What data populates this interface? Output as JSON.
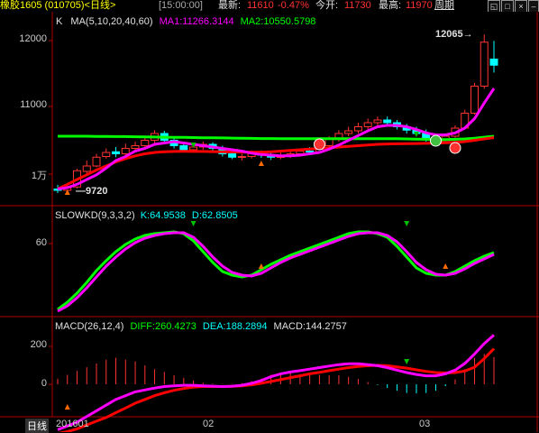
{
  "header": {
    "symbol": "橡胶1605 (010705)<日线>",
    "time": "[15:00:00]",
    "latest_label": "最新:",
    "latest_value": "11610",
    "change_pct": "-0.47%",
    "open_label": "今开:",
    "open_value": "11730",
    "high_label": "最高:",
    "high_value": "11970",
    "period_label": "周期"
  },
  "main_panel": {
    "k_label": "K",
    "ma_label": "MA(5,10,20,40,60)",
    "ma1": "MA1:11266.3144",
    "ma2": "MA2:10550.5798",
    "axis": [
      "12000",
      "11000",
      "1万"
    ],
    "high_mark": "12065",
    "low_mark": "9720",
    "colors": {
      "ma1": "#ff00ff",
      "ma2": "#00ff00",
      "ma3": "#ff0000",
      "up": "#ff3232",
      "down": "#00ffff"
    }
  },
  "kd_panel": {
    "label": "SLOWKD(9,3,3,2)",
    "k": "K:64.9538",
    "d": "D:62.8505",
    "axis": [
      "60"
    ]
  },
  "macd_panel": {
    "label": "MACD(26,12,4)",
    "diff": "DIFF:260.4273",
    "dea": "DEA:188.2894",
    "macd": "MACD:144.2757",
    "axis": [
      "200",
      "0"
    ]
  },
  "x_axis": {
    "period": "日线",
    "labels": [
      "201601",
      "02",
      "03"
    ]
  },
  "chart_data": {
    "type": "candlestick",
    "candles": [
      [
        9780,
        9760,
        9840,
        9720
      ],
      [
        9760,
        9800,
        9850,
        9740
      ],
      [
        9810,
        10050,
        10080,
        9790
      ],
      [
        10040,
        10120,
        10200,
        10000
      ],
      [
        10120,
        10250,
        10300,
        10100
      ],
      [
        10260,
        10320,
        10380,
        10230
      ],
      [
        10330,
        10300,
        10400,
        10250
      ],
      [
        10300,
        10380,
        10450,
        10280
      ],
      [
        10380,
        10420,
        10480,
        10340
      ],
      [
        10420,
        10500,
        10560,
        10380
      ],
      [
        10500,
        10600,
        10650,
        10460
      ],
      [
        10600,
        10500,
        10640,
        10450
      ],
      [
        10500,
        10420,
        10540,
        10380
      ],
      [
        10420,
        10360,
        10460,
        10320
      ],
      [
        10360,
        10400,
        10450,
        10330
      ],
      [
        10400,
        10440,
        10480,
        10360
      ],
      [
        10440,
        10380,
        10470,
        10330
      ],
      [
        10380,
        10300,
        10420,
        10260
      ],
      [
        10300,
        10250,
        10340,
        10220
      ],
      [
        10250,
        10260,
        10300,
        10200
      ],
      [
        10260,
        10310,
        10350,
        10230
      ],
      [
        10310,
        10280,
        10350,
        10240
      ],
      [
        10280,
        10250,
        10320,
        10210
      ],
      [
        10250,
        10260,
        10330,
        10220
      ],
      [
        10260,
        10300,
        10350,
        10240
      ],
      [
        10300,
        10340,
        10380,
        10270
      ],
      [
        10340,
        10330,
        10400,
        10290
      ],
      [
        10330,
        10420,
        10460,
        10300
      ],
      [
        10420,
        10520,
        10560,
        10400
      ],
      [
        10520,
        10600,
        10650,
        10480
      ],
      [
        10600,
        10640,
        10700,
        10560
      ],
      [
        10640,
        10700,
        10760,
        10600
      ],
      [
        10700,
        10760,
        10820,
        10660
      ],
      [
        10760,
        10800,
        10850,
        10720
      ],
      [
        10800,
        10760,
        10850,
        10700
      ],
      [
        10760,
        10700,
        10800,
        10660
      ],
      [
        10700,
        10650,
        10740,
        10600
      ],
      [
        10650,
        10600,
        10700,
        10560
      ],
      [
        10600,
        10520,
        10660,
        10480
      ],
      [
        10520,
        10480,
        10580,
        10440
      ],
      [
        10480,
        10560,
        10600,
        10450
      ],
      [
        10560,
        10680,
        10720,
        10540
      ],
      [
        10680,
        10900,
        10950,
        10660
      ],
      [
        10900,
        11300,
        11350,
        10880
      ],
      [
        11300,
        11950,
        12065,
        11260
      ],
      [
        11700,
        11610,
        11970,
        11500
      ]
    ],
    "ma1": [
      9780,
      9800,
      9850,
      9920,
      9990,
      10090,
      10200,
      10260,
      10340,
      10380,
      10440,
      10460,
      10480,
      10460,
      10440,
      10420,
      10400,
      10380,
      10360,
      10340,
      10310,
      10290,
      10280,
      10270,
      10270,
      10280,
      10300,
      10320,
      10370,
      10430,
      10500,
      10570,
      10640,
      10700,
      10720,
      10720,
      10700,
      10660,
      10610,
      10580,
      10580,
      10610,
      10680,
      10820,
      11050,
      11266
    ],
    "ma2": [
      10540,
      10540,
      10535,
      10530,
      10525,
      10520,
      10515,
      10510,
      10505,
      10500,
      10498,
      10496,
      10494,
      10492,
      10490,
      10488,
      10486,
      10484,
      10482,
      10480,
      10478,
      10476,
      10474,
      10472,
      10470,
      10470,
      10472,
      10474,
      10476,
      10478,
      10480,
      10482,
      10484,
      10486,
      10488,
      10490,
      10492,
      10494,
      10496,
      10498,
      10500,
      10505,
      10515,
      10525,
      10540,
      10550
    ],
    "ma3": [
      9780,
      9850,
      9920,
      9990,
      10060,
      10120,
      10180,
      10230,
      10270,
      10300,
      10320,
      10330,
      10335,
      10336,
      10335,
      10334,
      10332,
      10330,
      10328,
      10326,
      10325,
      10326,
      10330,
      10340,
      10350,
      10360,
      10370,
      10380,
      10390,
      10400,
      10410,
      10420,
      10430,
      10440,
      10445,
      10448,
      10450,
      10452,
      10455,
      10458,
      10462,
      10470,
      10480,
      10500,
      10520,
      10540
    ],
    "ma4": [
      10560,
      10560,
      10560,
      10560,
      10558,
      10556,
      10555,
      10554,
      10552,
      10550,
      10548,
      10546,
      10544,
      10542,
      10540,
      10538,
      10536,
      10534,
      10532,
      10530,
      10528,
      10526,
      10525,
      10524,
      10523,
      10522,
      10522,
      10522,
      10522,
      10522,
      10522,
      10522,
      10522,
      10522,
      10522,
      10522,
      10520,
      10518,
      10515,
      10512,
      10510,
      10515,
      10520,
      10530,
      10545,
      10560
    ],
    "kd_k": [
      2,
      10,
      20,
      32,
      45,
      56,
      66,
      74,
      80,
      84,
      86,
      87,
      88,
      86,
      78,
      66,
      54,
      44,
      40,
      38,
      40,
      46,
      52,
      57,
      62,
      66,
      70,
      74,
      78,
      82,
      86,
      88,
      88,
      86,
      82,
      72,
      60,
      48,
      42,
      40,
      40,
      44,
      50,
      56,
      61,
      65
    ],
    "kd_d": [
      0,
      6,
      15,
      26,
      38,
      50,
      60,
      69,
      76,
      81,
      84,
      86,
      87,
      87,
      82,
      72,
      60,
      50,
      43,
      40,
      39,
      42,
      48,
      54,
      59,
      63,
      67,
      71,
      75,
      79,
      83,
      86,
      87,
      87,
      84,
      77,
      66,
      54,
      46,
      41,
      40,
      42,
      47,
      53,
      58,
      63
    ],
    "macd_diff": [
      -240,
      -220,
      -200,
      -170,
      -140,
      -110,
      -80,
      -60,
      -40,
      -30,
      -20,
      -12,
      -8,
      -5,
      -5,
      -8,
      -10,
      -12,
      -10,
      -5,
      5,
      20,
      40,
      55,
      65,
      72,
      80,
      88,
      96,
      104,
      108,
      108,
      104,
      98,
      88,
      75,
      62,
      52,
      45,
      45,
      55,
      75,
      110,
      160,
      215,
      260
    ],
    "macd_dea": [
      -260,
      -250,
      -235,
      -215,
      -195,
      -175,
      -150,
      -125,
      -100,
      -80,
      -60,
      -45,
      -32,
      -22,
      -15,
      -12,
      -12,
      -12,
      -11,
      -8,
      -3,
      5,
      15,
      25,
      35,
      45,
      55,
      63,
      72,
      80,
      88,
      94,
      98,
      100,
      98,
      92,
      85,
      76,
      68,
      62,
      60,
      62,
      70,
      90,
      135,
      188
    ],
    "macd_bars": [
      30,
      50,
      70,
      90,
      110,
      130,
      140,
      130,
      120,
      100,
      80,
      65,
      48,
      34,
      20,
      8,
      4,
      2,
      2,
      6,
      16,
      30,
      50,
      60,
      60,
      54,
      50,
      50,
      48,
      48,
      40,
      28,
      12,
      -4,
      -20,
      -34,
      -46,
      -48,
      -46,
      -34,
      -10,
      26,
      80,
      140,
      160,
      144
    ]
  }
}
